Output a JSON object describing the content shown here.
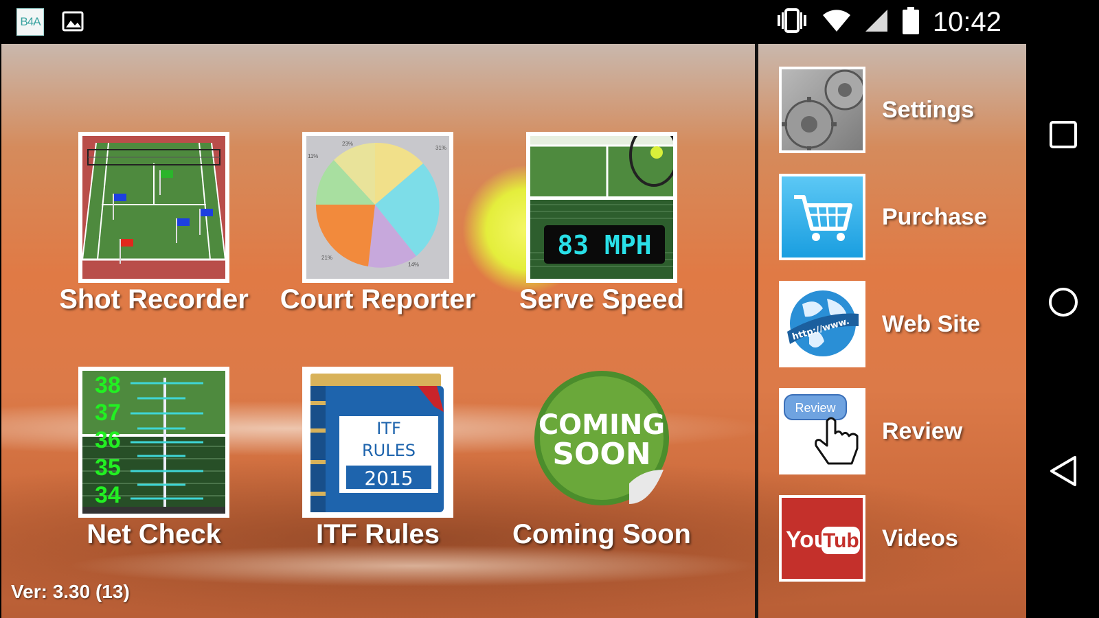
{
  "status_bar": {
    "time": "10:42",
    "app_icon_text": "B4A",
    "icons": [
      "b4a-app-icon",
      "image-notification-icon",
      "vibrate-icon",
      "wifi-icon",
      "cell-signal-icon",
      "battery-icon"
    ]
  },
  "tiles": [
    {
      "label": "Shot Recorder",
      "icon": "tennis-court-flags-icon"
    },
    {
      "label": "Court Reporter",
      "icon": "pie-chart-icon"
    },
    {
      "label": "Serve Speed",
      "icon": "speed-display-icon",
      "display_text": "83 MPH"
    },
    {
      "label": "Net Check",
      "icon": "net-gauge-icon",
      "numbers": [
        "38",
        "37",
        "36",
        "35",
        "34"
      ]
    },
    {
      "label": "ITF Rules",
      "icon": "rule-book-icon",
      "book_line1": "ITF",
      "book_line2": "RULES",
      "book_year": "2015"
    },
    {
      "label": "Coming Soon",
      "icon": "coming-soon-sticker-icon",
      "sticker_line1": "COMING",
      "sticker_line2": "SOON"
    }
  ],
  "sidebar": [
    {
      "label": "Settings",
      "icon": "gears-icon"
    },
    {
      "label": "Purchase",
      "icon": "shopping-cart-icon"
    },
    {
      "label": "Web Site",
      "icon": "globe-icon",
      "globe_text": "http://www."
    },
    {
      "label": "Review",
      "icon": "review-hand-icon",
      "badge_text": "Review"
    },
    {
      "label": "Videos",
      "icon": "youtube-icon",
      "logo_you": "You",
      "logo_tube": "Tube"
    }
  ],
  "pie_labels": [
    "23%",
    "11%",
    "31%",
    "21%",
    "14%"
  ],
  "version": "Ver: 3.30 (13)",
  "colors": {
    "court_green": "#4e8a3e",
    "clay": "#d97a46",
    "ball": "#e6ee3c",
    "speed_text": "#29e0e8",
    "net_numbers": "#22f022"
  }
}
